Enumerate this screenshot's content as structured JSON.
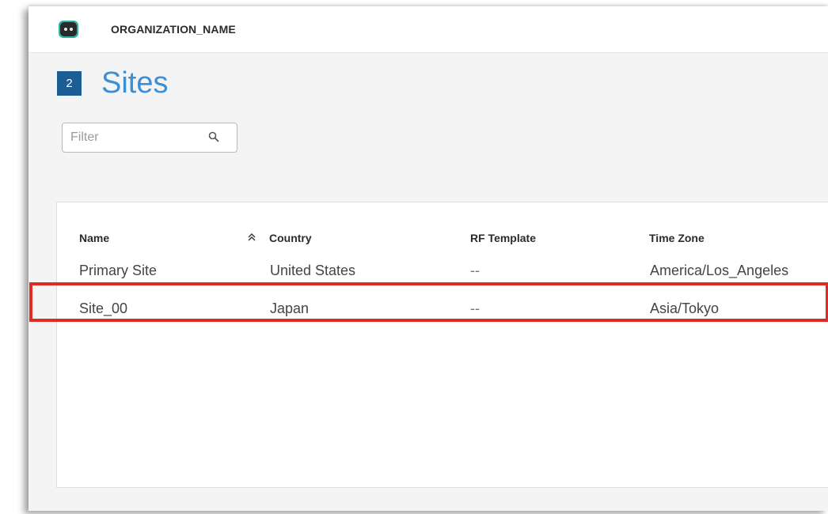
{
  "header": {
    "org_name": "ORGANIZATION_NAME",
    "logo_icon": "robot-face-logo-icon"
  },
  "page": {
    "count": "2",
    "title": "Sites"
  },
  "filter": {
    "placeholder": "Filter",
    "value": "",
    "icon": "search-icon"
  },
  "table": {
    "columns": [
      "Name",
      "Country",
      "RF Template",
      "Time Zone"
    ],
    "sort_icon": "sort-ascending-icon",
    "rows": [
      {
        "name": "Primary Site",
        "country": "United States",
        "rf_template": "--",
        "time_zone": "America/Los_Angeles"
      },
      {
        "name": "Site_00",
        "country": "Japan",
        "rf_template": "--",
        "time_zone": "Asia/Tokyo"
      }
    ]
  },
  "colors": {
    "accent": "#3a8fd6",
    "badge": "#1c5d96",
    "highlight": "#e02a24",
    "logo": "#2fb3a3"
  }
}
